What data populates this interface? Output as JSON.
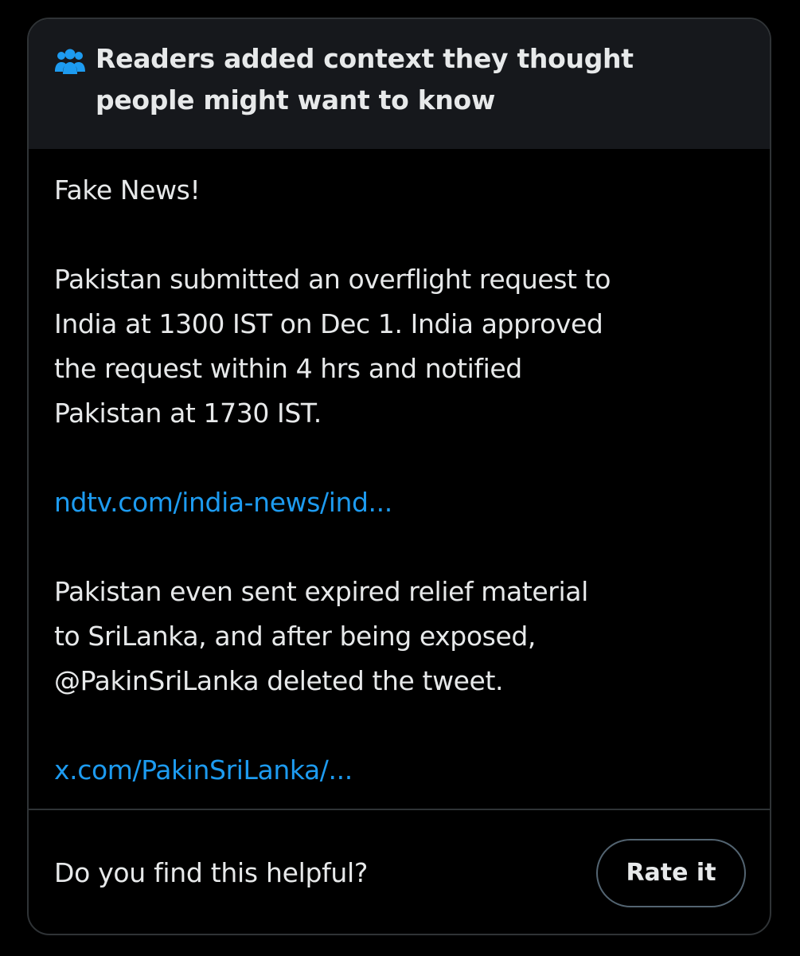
{
  "header": {
    "icon": "people-icon",
    "title": "Readers added context they thought people might want to know",
    "icon_color": "#1d9bf0"
  },
  "note": {
    "lines_group1": [
      "Fake News!"
    ],
    "lines_group2": [
      "Pakistan submitted an overflight request to",
      "India at 1300 IST on Dec 1. India approved",
      "the request within 4 hrs and notified",
      "Pakistan at 1730 IST."
    ],
    "link1": "ndtv.com/india-news/ind...",
    "lines_group3": [
      "Pakistan even sent expired relief material",
      "to SriLanka, and after being exposed,",
      "@PakinSriLanka deleted the tweet."
    ],
    "link2": "x.com/PakinSriLanka/..."
  },
  "footer": {
    "question": "Do you find this helpful?",
    "rate_label": "Rate it"
  },
  "colors": {
    "background": "#000000",
    "header_bg": "#16181c",
    "text": "#e7e9ea",
    "link": "#1d9bf0",
    "border": "#2f3336"
  }
}
